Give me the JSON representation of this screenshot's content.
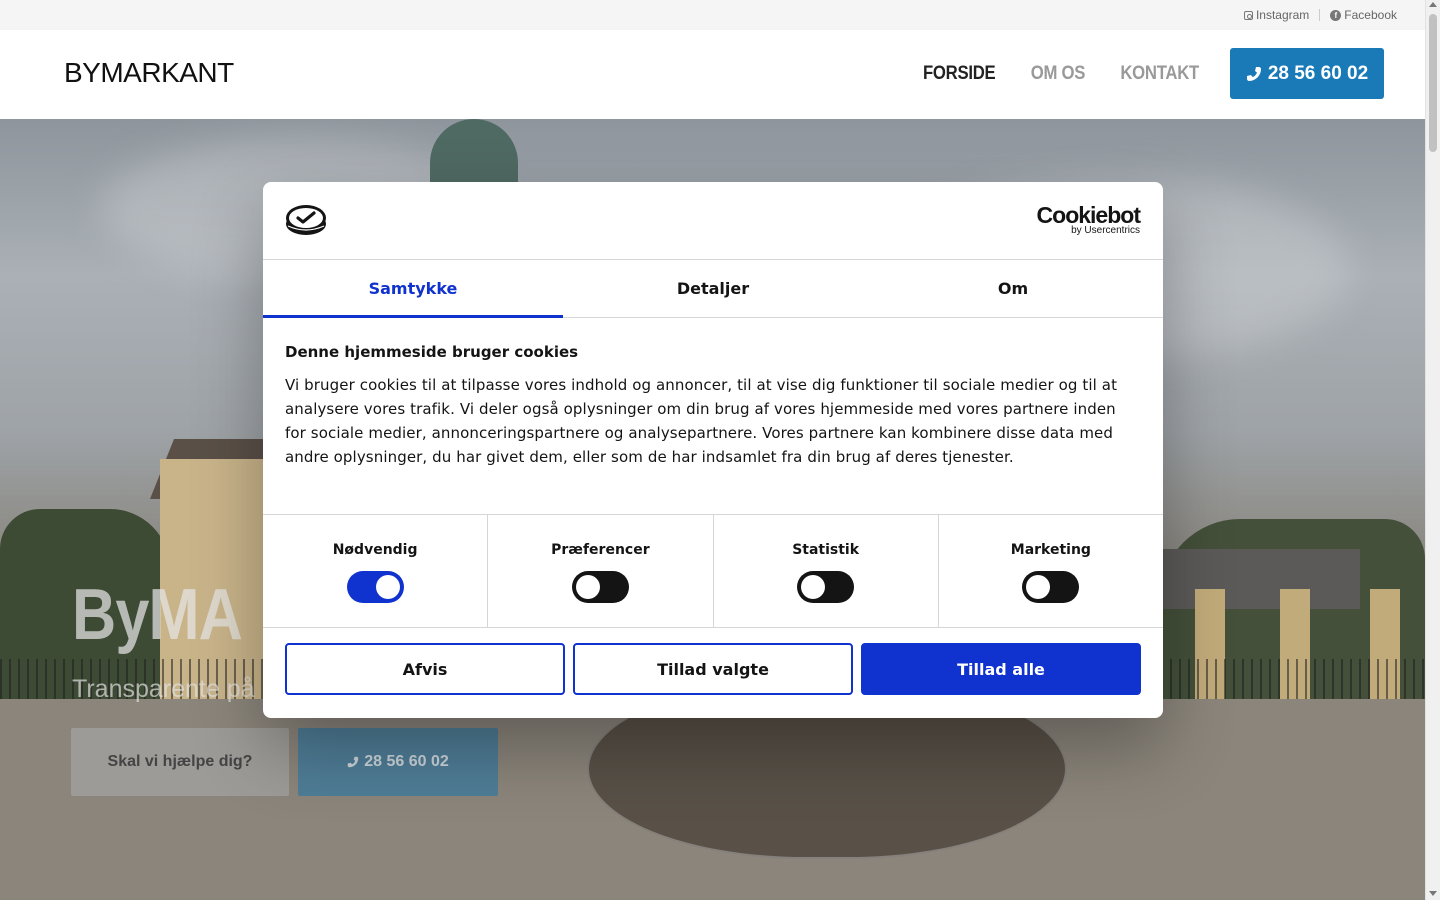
{
  "topbar": {
    "instagram": "Instagram",
    "facebook": "Facebook"
  },
  "header": {
    "logo": "BYMARKANT",
    "nav": [
      "FORSIDE",
      "OM OS",
      "KONTAKT"
    ],
    "phone": "28 56 60 02"
  },
  "hero": {
    "title": "ByMA",
    "subtitle": "Transparente på",
    "help_button": "Skal vi hjælpe dig?",
    "phone_button": "28 56 60 02"
  },
  "cookie": {
    "brand": "Cookiebot",
    "brand_by": "by Usercentrics",
    "tabs": [
      "Samtykke",
      "Detaljer",
      "Om"
    ],
    "active_tab": "Samtykke",
    "heading": "Denne hjemmeside bruger cookies",
    "text": "Vi bruger cookies til at tilpasse vores indhold og annoncer, til at vise dig funktioner til sociale medier og til at analysere vores trafik. Vi deler også oplysninger om din brug af vores hjemmeside med vores partnere inden for sociale medier, annonceringspartnere og analysepartnere. Vores partnere kan kombinere disse data med andre oplysninger, du har givet dem, eller som de har indsamlet fra din brug af deres tjenester.",
    "toggles": [
      {
        "label": "Nødvendig",
        "on": true
      },
      {
        "label": "Præferencer",
        "on": false
      },
      {
        "label": "Statistik",
        "on": false
      },
      {
        "label": "Marketing",
        "on": false
      }
    ],
    "buttons": {
      "deny": "Afvis",
      "allow_selected": "Tillad valgte",
      "allow_all": "Tillad alle"
    }
  },
  "colors": {
    "accent_blue": "#1032cf",
    "phone_blue": "#1a7ab8",
    "text_dark": "#141414"
  }
}
